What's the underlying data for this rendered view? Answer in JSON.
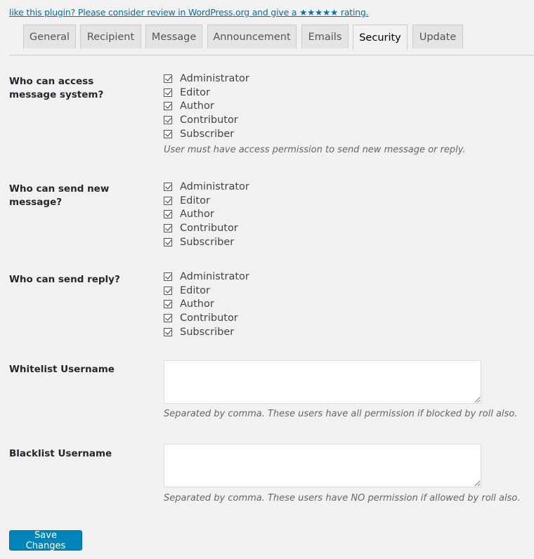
{
  "notice": {
    "rate_link": "like this plugin? Please consider review in WordPress.org and give a ★★★★★ rating."
  },
  "tabs": [
    {
      "label": "General",
      "active": false
    },
    {
      "label": "Recipient",
      "active": false
    },
    {
      "label": "Message",
      "active": false
    },
    {
      "label": "Announcement",
      "active": false
    },
    {
      "label": "Emails",
      "active": false
    },
    {
      "label": "Security",
      "active": true
    },
    {
      "label": "Update",
      "active": false
    }
  ],
  "sections": {
    "access": {
      "label": "Who can access message system?",
      "roles": [
        {
          "label": "Administrator",
          "checked": true
        },
        {
          "label": "Editor",
          "checked": true
        },
        {
          "label": "Author",
          "checked": true
        },
        {
          "label": "Contributor",
          "checked": true
        },
        {
          "label": "Subscriber",
          "checked": true
        }
      ],
      "description": "User must have access permission to send new message or reply."
    },
    "send_new": {
      "label": "Who can send new message?",
      "roles": [
        {
          "label": "Administrator",
          "checked": true
        },
        {
          "label": "Editor",
          "checked": true
        },
        {
          "label": "Author",
          "checked": true
        },
        {
          "label": "Contributor",
          "checked": true
        },
        {
          "label": "Subscriber",
          "checked": true
        }
      ]
    },
    "send_reply": {
      "label": "Who can send reply?",
      "roles": [
        {
          "label": "Administrator",
          "checked": true
        },
        {
          "label": "Editor",
          "checked": true
        },
        {
          "label": "Author",
          "checked": true
        },
        {
          "label": "Contributor",
          "checked": true
        },
        {
          "label": "Subscriber",
          "checked": true
        }
      ]
    },
    "whitelist": {
      "label": "Whitelist Username",
      "value": "",
      "description": "Separated by comma. These users have all permission if blocked by roll also."
    },
    "blacklist": {
      "label": "Blacklist Username",
      "value": "",
      "description": "Separated by comma. These users have NO permission if allowed by roll also."
    }
  },
  "save_button": "Save Changes"
}
